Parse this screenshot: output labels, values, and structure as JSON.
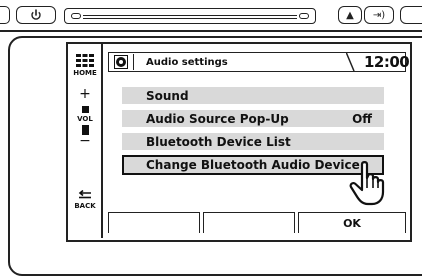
{
  "hardware": {
    "power_icon": "power-icon",
    "eject_icon": "eject-icon",
    "skip_icon": "skip-next-icon",
    "eject_label": "▲",
    "skip_label": "⇥)"
  },
  "side": {
    "home_label": "HOME",
    "vol_plus": "+",
    "vol_label": "VOL",
    "vol_minus": "−",
    "back_label": "BACK"
  },
  "header": {
    "title": "Audio settings",
    "clock": "12:00"
  },
  "menu": {
    "items": [
      {
        "label": "Sound",
        "value": ""
      },
      {
        "label": "Audio Source Pop-Up",
        "value": "Off"
      },
      {
        "label": "Bluetooth Device List",
        "value": ""
      },
      {
        "label": "Change Bluetooth Audio Device",
        "value": ""
      }
    ],
    "selected_index": 3
  },
  "softkeys": {
    "labels": [
      "",
      "",
      "OK"
    ]
  },
  "colors": {
    "row_background": "#d9d9d9",
    "outline": "#222222"
  }
}
